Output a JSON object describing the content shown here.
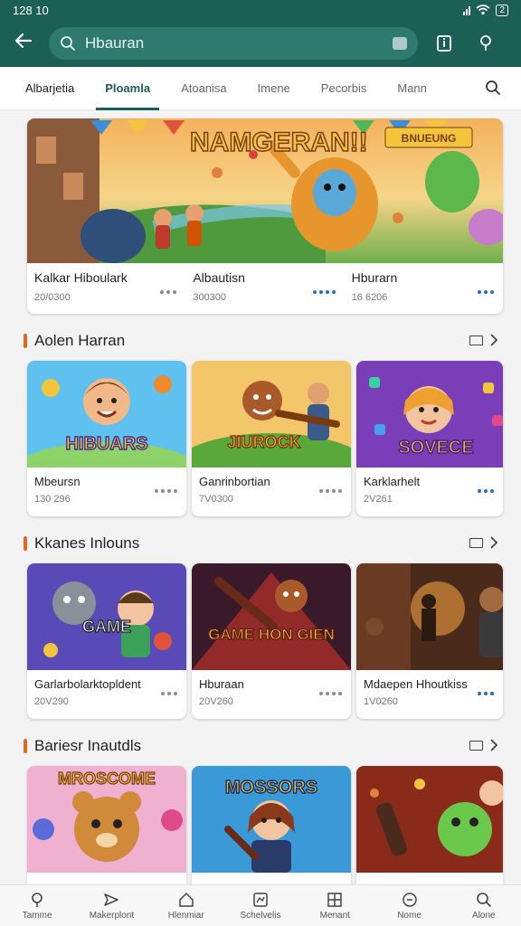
{
  "status_bar": {
    "time": "128 10",
    "battery": "2"
  },
  "search": {
    "value": "Hbauran"
  },
  "tabs": [
    {
      "label": "Albarjetia"
    },
    {
      "label": "Ploamla"
    },
    {
      "label": "Atoanisa"
    },
    {
      "label": "Imene"
    },
    {
      "label": "Pecorbis"
    },
    {
      "label": "Mann"
    }
  ],
  "hero": {
    "banner_text": "NAMGERAN!!",
    "badge_text": "BNUEUNG",
    "items": [
      {
        "title": "Kalkar Hiboulark",
        "meta": "20/0300"
      },
      {
        "title": "Albautisn",
        "meta": "300300"
      },
      {
        "title": "Hburarn",
        "meta": "16 6206"
      }
    ]
  },
  "sections": [
    {
      "title": "Aolen Harran",
      "cards": [
        {
          "title": "Mbeursn",
          "meta": "130 296",
          "art_text": "HIBUARS"
        },
        {
          "title": "Ganrinbortian",
          "meta": "7V0300",
          "art_text": "JIUROCK"
        },
        {
          "title": "Karklarhelt",
          "meta": "2V261",
          "art_text": "SOVECE"
        }
      ]
    },
    {
      "title": "Kkanes Inlouns",
      "cards": [
        {
          "title": "Garlarbolarktopldent",
          "meta": "20V290",
          "art_text": "GAME"
        },
        {
          "title": "Hburaan",
          "meta": "20V260",
          "art_text": "GAME HON GIEN"
        },
        {
          "title": "Mdaepen Hhoutkiss",
          "meta": "1V0260",
          "art_text": ""
        }
      ]
    },
    {
      "title": "Bariesr Inautdls",
      "cards": [
        {
          "title": "",
          "meta": "",
          "art_text": "MROSCOME"
        },
        {
          "title": "",
          "meta": "",
          "art_text": "MOSSORS"
        },
        {
          "title": "",
          "meta": "",
          "art_text": ""
        }
      ]
    }
  ],
  "bottom_nav": [
    {
      "label": "Tamme",
      "icon": "pin-icon"
    },
    {
      "label": "Makerplont",
      "icon": "paper-plane-icon"
    },
    {
      "label": "Hlenmiar",
      "icon": "home-icon"
    },
    {
      "label": "Schelvelis",
      "icon": "activity-icon"
    },
    {
      "label": "Menant",
      "icon": "grid-icon"
    },
    {
      "label": "Nome",
      "icon": "cart-icon"
    },
    {
      "label": "Alone",
      "icon": "search-icon"
    }
  ],
  "colors": {
    "primary": "#1b5f55",
    "accent": "#e06820",
    "dots_blue": "#2a6dbe"
  }
}
